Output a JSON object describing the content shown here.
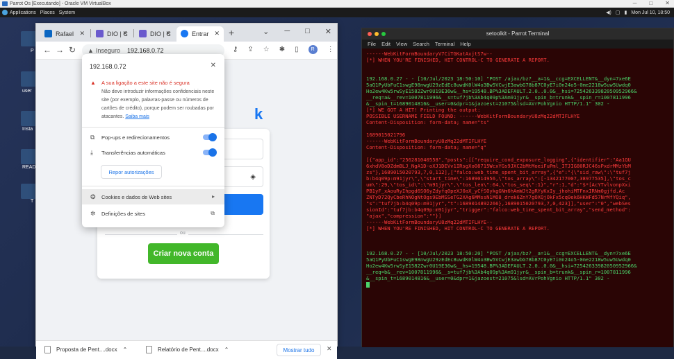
{
  "vbox": {
    "title": "Parrot Os [Executando] - Oracle VM VirtualBox",
    "min": "─",
    "restore": "□",
    "close": "✕"
  },
  "gnome": {
    "menus": [
      "Applications",
      "Places",
      "System"
    ],
    "datetime": "Mon Jul 10, 18:50"
  },
  "desktop": {
    "icons": [
      "P",
      "user",
      "Insta",
      "READM",
      "T"
    ]
  },
  "browser": {
    "tabs": [
      {
        "label": "Rafael",
        "fav_color": "#0a66c2"
      },
      {
        "label": "DIO | C",
        "fav_color": "#6a5acd"
      },
      {
        "label": "DIO | C",
        "fav_color": "#6a5acd"
      },
      {
        "label": "Entrar",
        "fav_color": "#1877f2"
      }
    ],
    "url_warning": "Inseguro",
    "url": "192.168.0.72",
    "avatar_letter": "R"
  },
  "site_popup": {
    "host": "192.168.0.72",
    "warning_title": "A sua ligação a este site não é segura",
    "warning_body": "Não deve introduzir informações confidenciais neste site (por exemplo, palavras-passe ou números de cartões de crédito), porque podem ser roubadas por atacantes.",
    "learn_more": "Saiba mais",
    "popups_label": "Pop-ups e redirecionamentos",
    "downloads_label": "Transferências automáticas",
    "reset_label": "Repor autorizações",
    "cookies_label": "Cookies e dados de Web sites",
    "site_settings_label": "Definições de sites"
  },
  "facebook": {
    "or_label": "ou",
    "create_account": "Criar nova conta",
    "logo_fragment": "k"
  },
  "downloads": {
    "items": [
      "Proposta de Pent....docx",
      "Relatório de Pent....docx"
    ],
    "show_all": "Mostrar tudo"
  },
  "terminal": {
    "title": "setoolkit - Parrot Terminal",
    "menu": [
      "File",
      "Edit",
      "View",
      "Search",
      "Terminal",
      "Help"
    ],
    "lines": [
      {
        "c": "r",
        "t": "------WebKitFormBoundaryV7CiTGKatAxjtS7w--"
      },
      {
        "c": "r",
        "t": "[*] WHEN YOU'RE FINISHED, HIT CONTROL-C TO GENERATE A REPORT."
      },
      {
        "c": "r",
        "t": ""
      },
      {
        "c": "r",
        "t": ""
      },
      {
        "c": "g",
        "t": "192.168.0.27 - - [10/Jul/2023 18:50:10] \"POST /ajax/bz?__a=1&__ccg=EXCELLENT&__dyn=7xe6E"
      },
      {
        "c": "g",
        "t": "5aQ1PyUbFuC1swgE98nwgU29zEdEc8uwdK0lW4o3Bw5VCwjE3awbG78b87C0yE7i0n24o5-0me2218w5uw5Uwdq0"
      },
      {
        "c": "g",
        "t": "Ho2ew4Kw5rwSyE1582Zwr0U19E36w&__hs=19548.BP%3ADEFAULT.2.0..0.0&__hsi=72542633982050952966&"
      },
      {
        "c": "g",
        "t": "__req=a&__rev=1007811996&__s=tuf7jb%3Ab4q09p%3Am91jyr&__spin_b=trunk&__spin_r=1007811996"
      },
      {
        "c": "g",
        "t": "&__spin_t=1689014816&__user=0&dpr=1&jazoest=21075&lsd=AVrPohVgnio HTTP/1.1\" 302 -"
      },
      {
        "c": "r",
        "t": "[*] WE GOT A HIT! Printing the output:"
      },
      {
        "c": "r",
        "t": "POSSIBLE USERNAME FIELD FOUND: ------WebKitFormBoundaryU8zMq22dMTIFLHYE"
      },
      {
        "c": "r",
        "t": "Content-Disposition: form-data; name=\"ts\""
      },
      {
        "c": "r",
        "t": ""
      },
      {
        "c": "r",
        "t": "1689015021796"
      },
      {
        "c": "r",
        "t": "------WebKitFormBoundaryU8zMq22dMTIFLHYE"
      },
      {
        "c": "r",
        "t": "Content-Disposition: form-data; name=\"q\""
      },
      {
        "c": "r",
        "t": ""
      },
      {
        "c": "r",
        "t": "[{\"app_id\":\"256281040558\",\"posts\":[[\"require_cond_exposure_logging\",{\"identifier\":\"Aa1QU"
      },
      {
        "c": "r",
        "t": "6xhdV8oDZdmBLJ_NgA1D-oXJ1DEVv1IRsgXo08715WcxYGs9JXC2bMtMoeiFuPml_ITJIG80RJC46sPxdrMMzYbM"
      },
      {
        "c": "r",
        "t": "zs\"},1689015020793,7,0,112],[\"falco:web_time_spent_bit_array\",{\"e\":\"{\\\"sid_raw\\\":\\\"tuf7j"
      },
      {
        "c": "r",
        "t": "b:b4q09p:m91jyr\\\",\\\"start_time\\\":1689014956,\\\"tos_array\\\":[-1342177007,38977535],\\\"tos_c"
      },
      {
        "c": "r",
        "t": "um\\\":29,\\\"tos_id\\\":\\\"m91jyr\\\",\\\"tos_len\\\":64,\\\"tos_seq\\\":1}\",\"r\":1,\"d\":\"$*[AcYTvlvonpXxi"
      },
      {
        "c": "r",
        "t": "PB1yF_xAouRyIhpgd6SO6yZdyfq0peXJ0aX_yCfSOykgGNm6hAmWJt2gRYyKxIy_jhohiMTFnxIRNm0gjfd.Ac"
      },
      {
        "c": "r",
        "t": "ZNTyD72QyCbeRhNOgNtOgs9EbMSSeTG2XAg6MMssN1MO8_drek6ZnY7gOXQjOkFx5cq0ek6HKWFd57NrMfYQiq\","
      },
      {
        "c": "r",
        "t": "\"s\":\"tuf7jb:b4q09p:m91jyr\",\"t\":1689014892266},1689015020793,7,0,423]],\"user\":\"0\",\"webSes"
      },
      {
        "c": "r",
        "t": "sionId\":\"tuf7jb:b4q09p:m91jyr\",\"trigger\":\"falco:web_time_spent_bit_array\",\"send_method\":"
      },
      {
        "c": "r",
        "t": "\"ajax\",\"compression\":\"\"}]"
      },
      {
        "c": "r",
        "t": "------WebKitFormBoundaryU8zMq22dMTIFLHYE--"
      },
      {
        "c": "r",
        "t": "[*] WHEN YOU'RE FINISHED, HIT CONTROL-C TO GENERATE A REPORT."
      },
      {
        "c": "r",
        "t": ""
      },
      {
        "c": "r",
        "t": ""
      },
      {
        "c": "r",
        "t": ""
      },
      {
        "c": "g",
        "t": "192.168.0.27 - - [10/Jul/2023 18:50:20] \"POST /ajax/bz?__a=1&__ccg=EXCELLENT&__dyn=7xe6E"
      },
      {
        "c": "g",
        "t": "5aQ1PyUbFuC1swgE98nwgU29zEdEc8uwdK0lW4o3Bw5VCwjE3awbG78b87C0yE7i0n24o5-0me2218w5uw5Uwdq0"
      },
      {
        "c": "g",
        "t": "Ho2ew4Kw5rwSyE1582Zwr0U19E36w&__hs=19548.BP%3ADEFAULT.2.0..0.0&__hsi=72542633982050952966&"
      },
      {
        "c": "g",
        "t": "__req=b&__rev=1007811996&__s=tuf7jb%3Ab4q09p%3Am91jyr&__spin_b=trunk&__spin_r=1007811996"
      },
      {
        "c": "g",
        "t": "&__spin_t=1689014816&__user=0&dpr=1&jazoest=21075&lsd=AVrPohVgnio HTTP/1.1\" 302 -"
      }
    ]
  }
}
